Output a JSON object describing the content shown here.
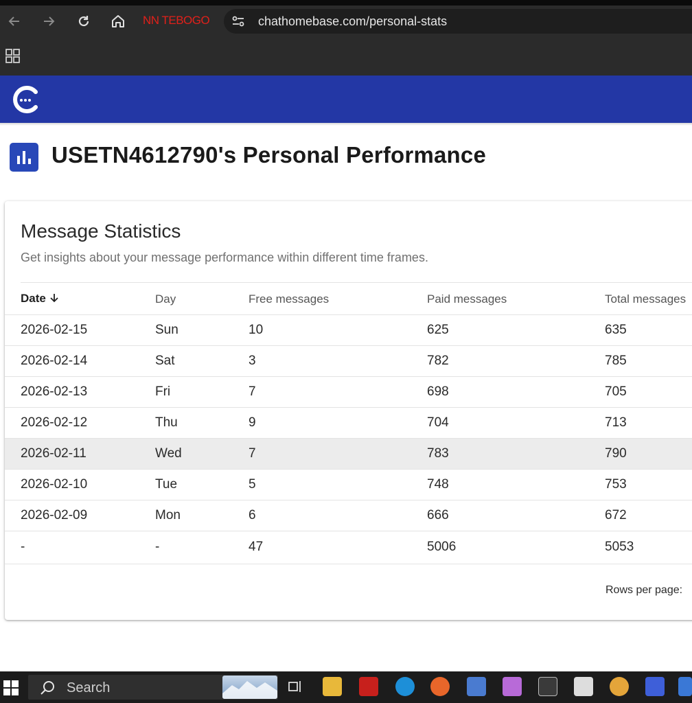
{
  "browser": {
    "profile_label": "NN TEBOGO",
    "url": "chathomebase.com/personal-stats"
  },
  "page": {
    "title": "USETN4612790's Personal Performance"
  },
  "card": {
    "title": "Message Statistics",
    "subtitle": "Get insights about your message performance within different time frames.",
    "columns": [
      "Date",
      "Day",
      "Free messages",
      "Paid messages",
      "Total messages"
    ],
    "rows": [
      [
        "2026-02-15",
        "Sun",
        "10",
        "625",
        "635"
      ],
      [
        "2026-02-14",
        "Sat",
        "3",
        "782",
        "785"
      ],
      [
        "2026-02-13",
        "Fri",
        "7",
        "698",
        "705"
      ],
      [
        "2026-02-12",
        "Thu",
        "9",
        "704",
        "713"
      ],
      [
        "2026-02-11",
        "Wed",
        "7",
        "783",
        "790"
      ],
      [
        "2026-02-10",
        "Tue",
        "5",
        "748",
        "753"
      ],
      [
        "2026-02-09",
        "Mon",
        "6",
        "666",
        "672"
      ]
    ],
    "totals": [
      "-",
      "-",
      "47",
      "5006",
      "5053"
    ],
    "rows_per_page_label": "Rows per page:"
  },
  "taskbar": {
    "search_label": "Search"
  },
  "colors": {
    "header_blue": "#2337a5",
    "title_icon_blue": "#2848b8",
    "highlight_row": "#ececec"
  },
  "icons": [
    "back-arrow-icon",
    "forward-arrow-icon",
    "reload-icon",
    "home-icon",
    "site-info-icon",
    "apps-grid-icon",
    "app-logo-icon",
    "bar-chart-icon",
    "sort-down-arrow-icon",
    "windows-start-icon",
    "search-icon"
  ]
}
